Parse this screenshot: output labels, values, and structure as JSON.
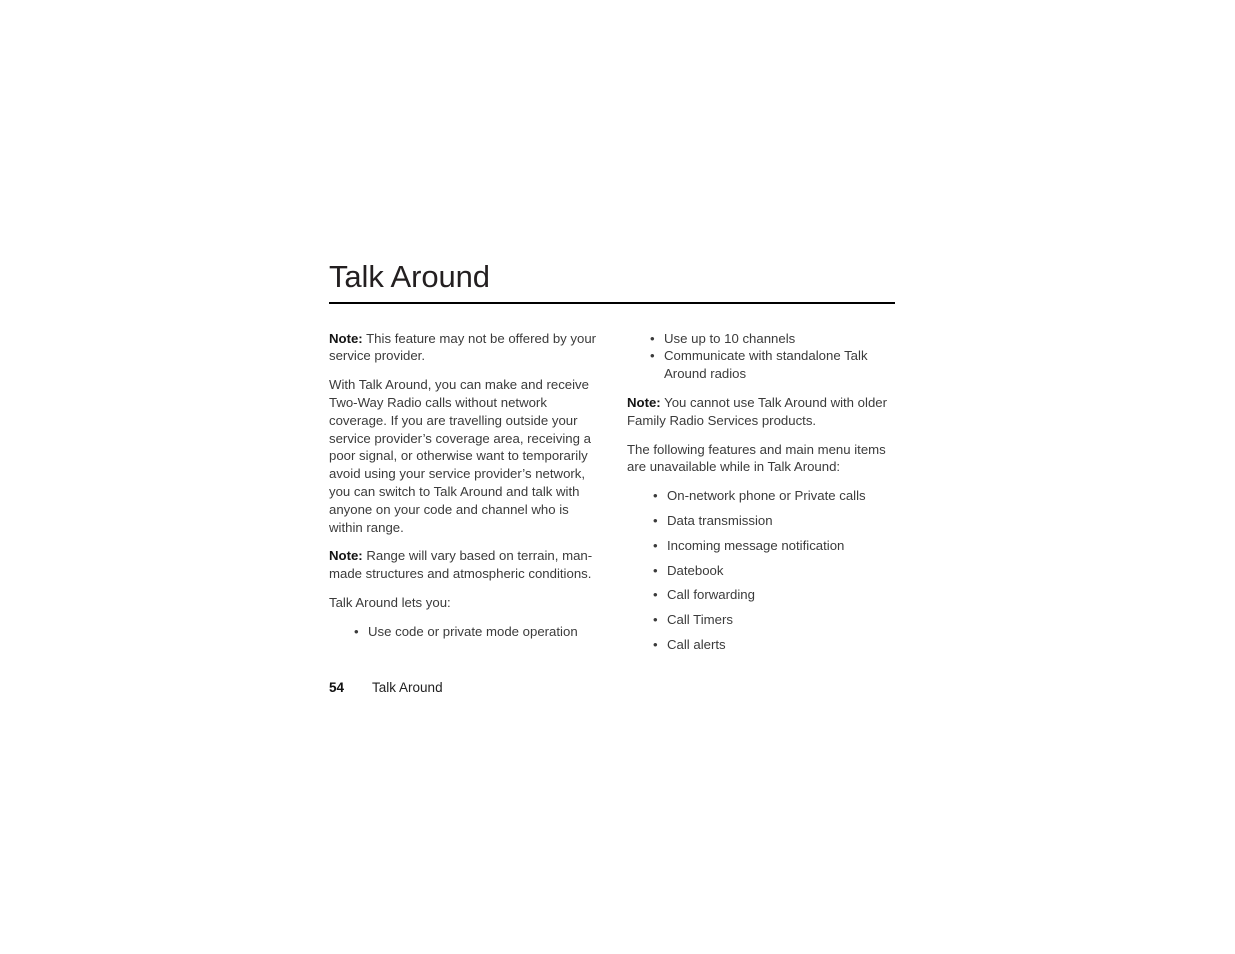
{
  "document": {
    "title": "Talk Around",
    "footer": {
      "page_number": "54",
      "chapter": "Talk Around"
    }
  },
  "left_column": {
    "note_1": {
      "label": "Note:",
      "text": " This feature may not be offered by your service provider."
    },
    "paragraph_1": "With Talk Around, you can make and receive Two-Way Radio calls without network coverage. If you are travelling outside your service provider’s coverage area, receiving a poor signal, or otherwise want to temporarily avoid using your service provider’s network, you can switch to Talk Around and talk with anyone on your code and channel who is within range.",
    "note_2": {
      "label": "Note:",
      "text": " Range will vary based on terrain, man-made structures and atmospheric conditions."
    },
    "lead_in": "Talk Around lets you:",
    "bullets": [
      "Use code or private mode operation"
    ]
  },
  "right_column": {
    "bullets_continued": [
      "Use up to 10 channels",
      "Communicate with standalone Talk Around radios"
    ],
    "note_3": {
      "label": "Note:",
      "text": " You cannot use Talk Around with older Family Radio Services products."
    },
    "lead_in": "The following features and main menu items are unavailable while in Talk Around:",
    "unavailable_features": [
      "On-network phone or Private calls",
      "Data transmission",
      "Incoming message notification",
      "Datebook",
      "Call forwarding",
      "Call Timers",
      "Call alerts"
    ]
  },
  "glyphs": {
    "bullet": "•"
  }
}
